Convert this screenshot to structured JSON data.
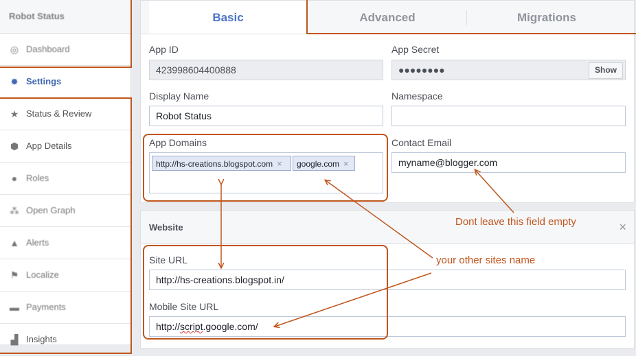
{
  "sidebar": {
    "header": "Robot Status",
    "items": [
      {
        "label": "Dashboard",
        "icon": "dashboard-icon"
      },
      {
        "label": "Settings",
        "icon": "gear-icon"
      },
      {
        "label": "Status & Review",
        "icon": "star-icon"
      },
      {
        "label": "App Details",
        "icon": "cube-icon"
      },
      {
        "label": "Roles",
        "icon": "person-icon"
      },
      {
        "label": "Open Graph",
        "icon": "graph-icon"
      },
      {
        "label": "Alerts",
        "icon": "warning-icon"
      },
      {
        "label": "Localize",
        "icon": "flag-icon"
      },
      {
        "label": "Payments",
        "icon": "card-icon"
      },
      {
        "label": "Insights",
        "icon": "chart-icon"
      }
    ],
    "active": "Settings"
  },
  "tabs": [
    {
      "label": "Basic",
      "active": true
    },
    {
      "label": "Advanced",
      "active": false
    },
    {
      "label": "Migrations",
      "active": false
    }
  ],
  "basic": {
    "app_id_label": "App ID",
    "app_id_value": "423998604400888",
    "app_secret_label": "App Secret",
    "app_secret_value": "●●●●●●●●",
    "show_label": "Show",
    "display_name_label": "Display Name",
    "display_name_value": "Robot Status",
    "namespace_label": "Namespace",
    "namespace_value": "",
    "app_domains_label": "App Domains",
    "app_domains": [
      "http://hs-creations.blogspot.com",
      "google.com"
    ],
    "token_remove": "×",
    "contact_email_label": "Contact Email",
    "contact_email_value": "myname@blogger.com"
  },
  "website": {
    "title": "Website",
    "close": "×",
    "site_url_label": "Site URL",
    "site_url_value": "http://hs-creations.blogspot.in/",
    "mobile_url_label": "Mobile Site URL",
    "mobile_url_prefix": "http://",
    "mobile_url_squiggle": "script",
    "mobile_url_suffix": ".google.com/"
  },
  "annotations": {
    "email_note": "Dont leave this field empty",
    "sites_note": "your other sites name",
    "color": "#c0551c"
  },
  "colors": {
    "accent": "#4267b2",
    "active_tab": "#4c75c9"
  }
}
